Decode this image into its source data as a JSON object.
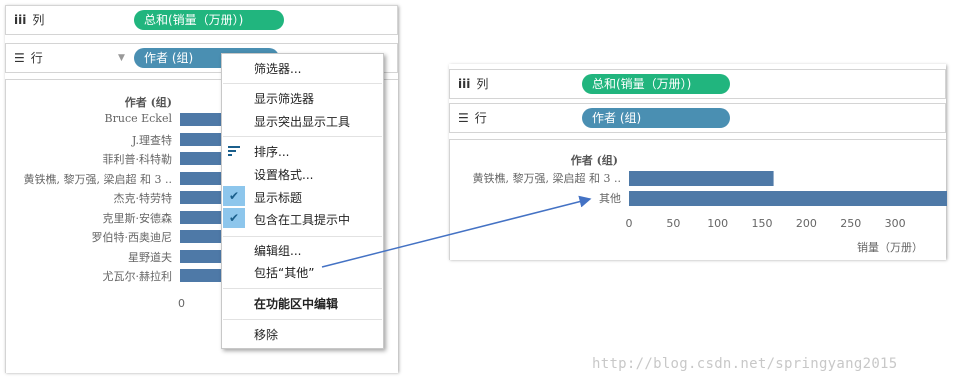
{
  "left": {
    "columns_shelf": {
      "icon": "iii",
      "label": "列",
      "pill": "总和(销量（万册）)"
    },
    "rows_shelf": {
      "icon": "☰",
      "label": "行",
      "pill": "作者 (组)"
    },
    "header": "作者 (组)",
    "authors": [
      "Bruce Eckel",
      "J.理查特",
      "菲利普·科特勒",
      "黄铁樵, 黎万强, 梁启超 和 3 ..",
      "杰克·特劳特",
      "克里斯·安德森",
      "罗伯特·西奥迪尼",
      "星野道夫",
      "尤瓦尔·赫拉利"
    ],
    "axis_zero": "0"
  },
  "menu": {
    "items": [
      {
        "label": "筛选器...",
        "bold": false
      },
      {
        "label": "显示筛选器",
        "bold": false
      },
      {
        "label": "显示突出显示工具",
        "bold": false
      },
      {
        "label": "排序...",
        "bold": false
      },
      {
        "label": "设置格式...",
        "bold": false
      },
      {
        "label": "显示标题",
        "bold": false,
        "checked": true
      },
      {
        "label": "包含在工具提示中",
        "bold": false,
        "checked": true
      },
      {
        "label": "编辑组...",
        "bold": false
      },
      {
        "label": "包括“其他”",
        "bold": false
      },
      {
        "label": "在功能区中编辑",
        "bold": true
      },
      {
        "label": "移除",
        "bold": false
      }
    ]
  },
  "right": {
    "columns_shelf": {
      "icon": "iii",
      "label": "列",
      "pill": "总和(销量（万册）)"
    },
    "rows_shelf": {
      "icon": "☰",
      "label": "行",
      "pill": "作者 (组)"
    },
    "header": "作者 (组)",
    "axis_title": "销量（万册）"
  },
  "chart_data": {
    "type": "bar",
    "orientation": "horizontal",
    "categories": [
      "黄铁樵, 黎万强, 梁启超 和 3 ..",
      "其他"
    ],
    "values": [
      163,
      370
    ],
    "xticks": [
      0,
      50,
      100,
      150,
      200,
      250,
      300
    ],
    "xlim": [
      0,
      370
    ],
    "xlabel": "销量（万册）",
    "ylabel": "作者 (组)",
    "color": "#4e79a7"
  },
  "watermark": "http://blog.csdn.net/springyang2015",
  "colors": {
    "measure_pill": "#21b57e",
    "dimension_pill": "#4a8fb2",
    "bar": "#4e79a7",
    "check_bg": "#8dc6ec"
  }
}
